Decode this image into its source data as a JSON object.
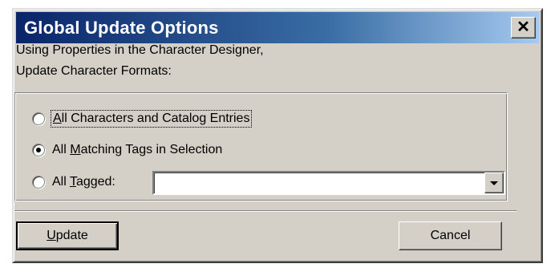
{
  "window": {
    "title": "Global Update Options",
    "close_glyph": "✕"
  },
  "intro": {
    "line1": "Using Properties in the Character Designer,",
    "line2": "Update Character Formats:"
  },
  "options": [
    {
      "mnemonic": "A",
      "rest": "ll Characters and Catalog Entries",
      "checked": false
    },
    {
      "prefix": "All ",
      "mnemonic": "M",
      "rest": "atching Tags in Selection",
      "checked": true
    },
    {
      "prefix": "All ",
      "mnemonic": "T",
      "rest": "agged:",
      "checked": false
    }
  ],
  "tagged_combo": {
    "value": "",
    "dropdown_icon": "down-arrow"
  },
  "buttons": {
    "update": {
      "mnemonic": "U",
      "rest": "pdate"
    },
    "cancel": "Cancel"
  },
  "colors": {
    "titlebar_start": "#0a246a",
    "titlebar_end": "#a6caf0",
    "face": "#d4d0c8"
  }
}
